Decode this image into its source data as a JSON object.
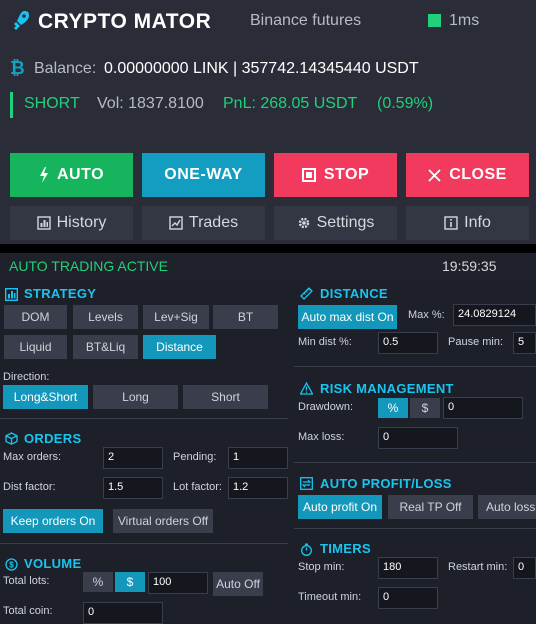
{
  "header": {
    "brand": "CRYPTO MATOR",
    "exchange": "Binance futures",
    "ping": "1ms",
    "balance_label": "Balance:",
    "balance_value": "0.00000000 LINK | 357742.14345440 USDT",
    "position": {
      "side": "SHORT",
      "vol": "Vol: 1837.8100",
      "pnl": "PnL: 268.05 USDT",
      "pct": "(0.59%)"
    },
    "actions": {
      "auto": "AUTO",
      "oneway": "ONE-WAY",
      "stop": "STOP",
      "close": "CLOSE"
    },
    "tabs": {
      "history": "History",
      "trades": "Trades",
      "settings": "Settings",
      "info": "Info"
    }
  },
  "status": {
    "text": "AUTO TRADING ACTIVE",
    "time": "19:59:35"
  },
  "strategy": {
    "title": "STRATEGY",
    "modes": [
      "DOM",
      "Levels",
      "Lev+Sig",
      "BT",
      "Liquid",
      "BT&Liq",
      "Distance"
    ],
    "active_mode": "Distance",
    "direction_label": "Direction:",
    "directions": [
      "Long&Short",
      "Long",
      "Short"
    ],
    "active_direction": "Long&Short"
  },
  "orders": {
    "title": "ORDERS",
    "max_orders_label": "Max orders:",
    "max_orders": "2",
    "pending_label": "Pending:",
    "pending": "1",
    "dist_factor_label": "Dist factor:",
    "dist_factor": "1.5",
    "lot_factor_label": "Lot factor:",
    "lot_factor": "1.2",
    "keep_orders": "Keep orders On",
    "virtual_orders": "Virtual orders Off"
  },
  "volume": {
    "title": "VOLUME",
    "total_lots_label": "Total lots:",
    "pct_btn": "%",
    "usd_btn": "$",
    "total_lots": "100",
    "auto_btn": "Auto Off",
    "total_coin_label": "Total coin:",
    "total_coin": "0"
  },
  "distance": {
    "title": "DISTANCE",
    "auto_max": "Auto max dist On",
    "max_pct_label": "Max %:",
    "max_pct": "24.0829124",
    "min_dist_label": "Min dist %:",
    "min_dist": "0.5",
    "pause_min_label": "Pause min:",
    "pause_min": "5"
  },
  "risk": {
    "title": "RISK MANAGEMENT",
    "drawdown_label": "Drawdown:",
    "pct_btn": "%",
    "usd_btn": "$",
    "drawdown": "0",
    "max_loss_label": "Max loss:",
    "max_loss": "0"
  },
  "auto_pl": {
    "title": "AUTO PROFIT/LOSS",
    "auto_profit": "Auto profit On",
    "real_tp": "Real TP Off",
    "auto_loss": "Auto loss"
  },
  "timers": {
    "title": "TIMERS",
    "stop_min_label": "Stop min:",
    "stop_min": "180",
    "restart_min_label": "Restart min:",
    "restart_min": "0",
    "timeout_min_label": "Timeout min:",
    "timeout_min": "0"
  },
  "colors": {
    "green": "#21d07a",
    "cyan": "#19c5f0",
    "red": "#f23a5e",
    "blue": "#139dc0"
  }
}
